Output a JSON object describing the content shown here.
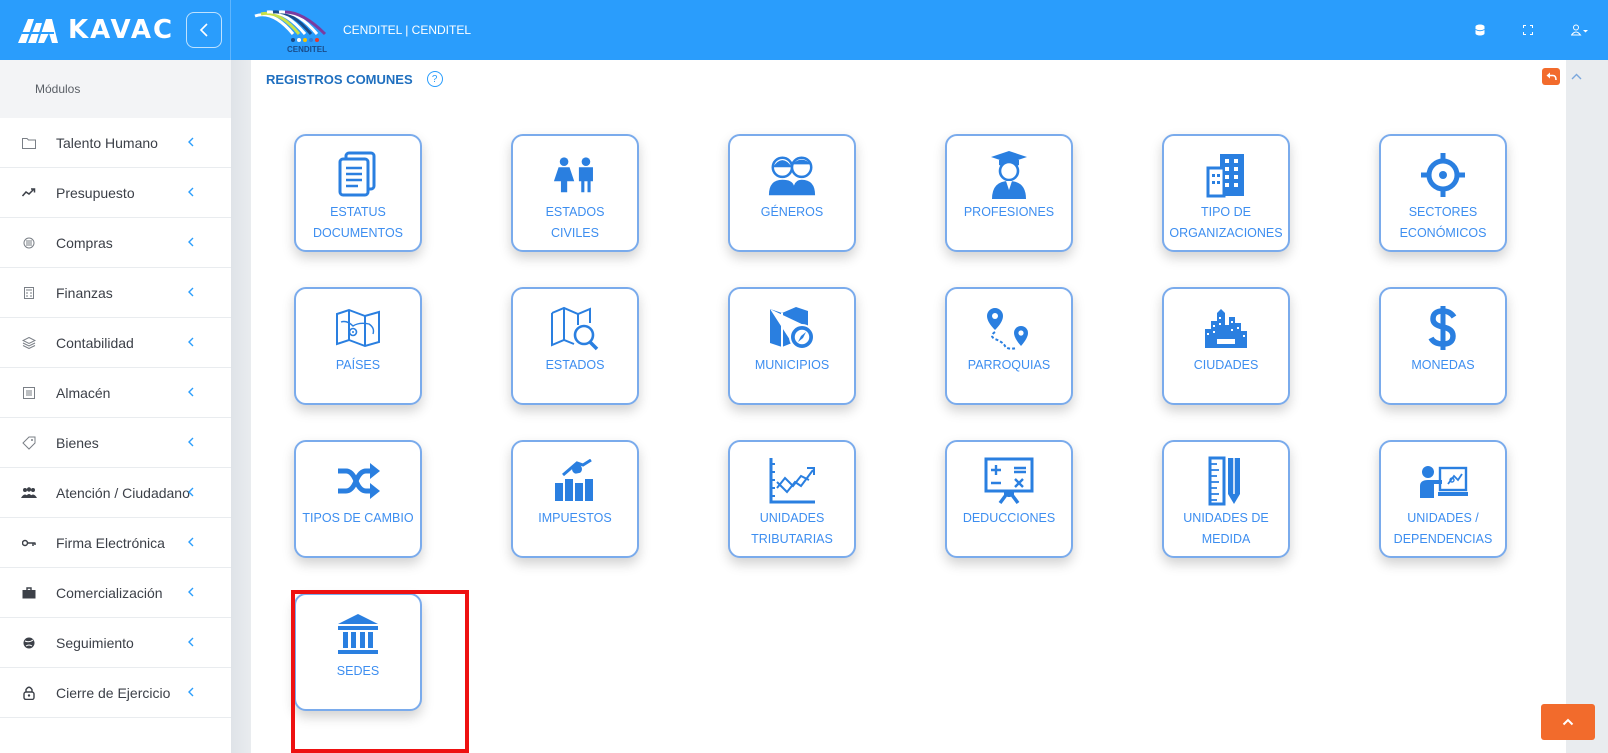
{
  "app": {
    "brand": "KAVAC",
    "institution": "CENDITEL | CENDITEL",
    "institution_logo_text": "CENDITEL"
  },
  "sidebar": {
    "section_title": "Módulos",
    "items": [
      {
        "label": "Talento Humano",
        "icon": "folder-icon"
      },
      {
        "label": "Presupuesto",
        "icon": "trend-icon"
      },
      {
        "label": "Compras",
        "icon": "compras-icon"
      },
      {
        "label": "Finanzas",
        "icon": "calculator-icon"
      },
      {
        "label": "Contabilidad",
        "icon": "layers-icon"
      },
      {
        "label": "Almacén",
        "icon": "list-icon"
      },
      {
        "label": "Bienes",
        "icon": "tag-icon"
      },
      {
        "label": "Atención / Ciudadano",
        "icon": "users-icon"
      },
      {
        "label": "Firma Electrónica",
        "icon": "key-icon"
      },
      {
        "label": "Comercialización",
        "icon": "briefcase-icon"
      },
      {
        "label": "Seguimiento",
        "icon": "globe-icon"
      },
      {
        "label": "Cierre de Ejercicio",
        "icon": "lock-icon"
      }
    ]
  },
  "main": {
    "title": "REGISTROS COMUNES",
    "help": "?",
    "tiles": [
      {
        "label": "ESTATUS DOCUMENTOS",
        "icon": "documents-icon"
      },
      {
        "label": "ESTADOS CIVILES",
        "icon": "couple-icon"
      },
      {
        "label": "GÉNEROS",
        "icon": "genders-icon"
      },
      {
        "label": "PROFESIONES",
        "icon": "graduate-icon"
      },
      {
        "label": "TIPO DE ORGANIZACIONES",
        "icon": "building-icon"
      },
      {
        "label": "SECTORES ECONÓMICOS",
        "icon": "target-icon"
      },
      {
        "label": "PAÍSES",
        "icon": "world-map-icon"
      },
      {
        "label": "ESTADOS",
        "icon": "map-search-icon"
      },
      {
        "label": "MUNICIPIOS",
        "icon": "map-compass-icon"
      },
      {
        "label": "PARROQUIAS",
        "icon": "route-pins-icon"
      },
      {
        "label": "CIUDADES",
        "icon": "city-icon"
      },
      {
        "label": "MONEDAS",
        "icon": "dollar-icon"
      },
      {
        "label": "TIPOS DE CAMBIO",
        "icon": "shuffle-icon"
      },
      {
        "label": "IMPUESTOS",
        "icon": "tax-chart-icon"
      },
      {
        "label": "UNIDADES TRIBUTARIAS",
        "icon": "line-chart-icon"
      },
      {
        "label": "DEDUCCIONES",
        "icon": "math-board-icon"
      },
      {
        "label": "UNIDADES DE MEDIDA",
        "icon": "ruler-pencil-icon"
      },
      {
        "label": "UNIDADES / DEPENDENCIAS",
        "icon": "presenter-icon"
      },
      {
        "label": "SEDES",
        "icon": "bank-icon"
      }
    ]
  },
  "colors": {
    "primary": "#2a9dfc",
    "tile_text": "#3d8ef0",
    "tile_icon": "#2a7fe0",
    "accent": "#f26b2c",
    "highlight": "#ee1111"
  }
}
